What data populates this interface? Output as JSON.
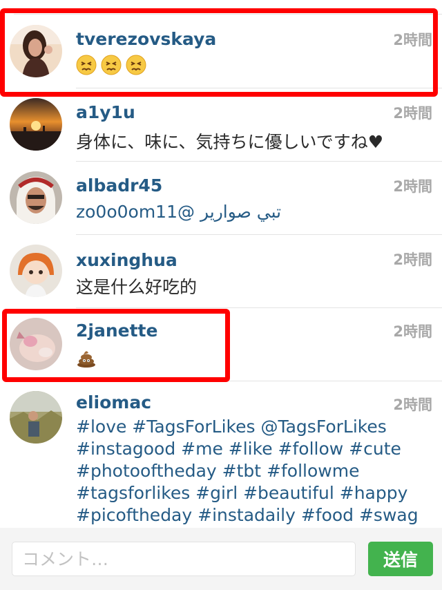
{
  "comments": [
    {
      "username": "tverezovskaya",
      "time": "2時間",
      "text": "",
      "avatar": "portrait of woman",
      "emoji": [
        "persevering-face-emoji",
        "persevering-face-emoji",
        "persevering-face-emoji"
      ]
    },
    {
      "username": "a1y1u",
      "time": "2時間",
      "text": "身体に、味に、気持ちに優しいですね♥",
      "avatar": "sunset skyline photo"
    },
    {
      "username": "albadr45",
      "time": "2時間",
      "text": "zo0o0om11@ تبي صوارير",
      "avatar": "man in headscarf"
    },
    {
      "username": "xuxinghua",
      "time": "2時間",
      "text": "这是什么好吃的",
      "avatar": "anime figure"
    },
    {
      "username": "2janette",
      "time": "2時間",
      "text": "",
      "avatar": "pink cat photo",
      "emoji": [
        "pile-of-poo-emoji"
      ]
    },
    {
      "username": "eliomac",
      "time": "2時間",
      "text": "",
      "avatar": "man outdoors",
      "tags": [
        "#love #TagsForLikes @TagsForLikes",
        "#instagood #me #like #follow #cute",
        "#photooftheday #tbt #followme",
        "#tagsforlikes #girl #beautiful #happy",
        "#picoftheday #instadaily #food #swag"
      ]
    }
  ],
  "composer": {
    "placeholder": "コメント…",
    "send_label": "送信"
  },
  "colors": {
    "username": "#255b85",
    "time": "#a8a8a8",
    "send": "#43b34e",
    "highlight": "#ff0000"
  }
}
